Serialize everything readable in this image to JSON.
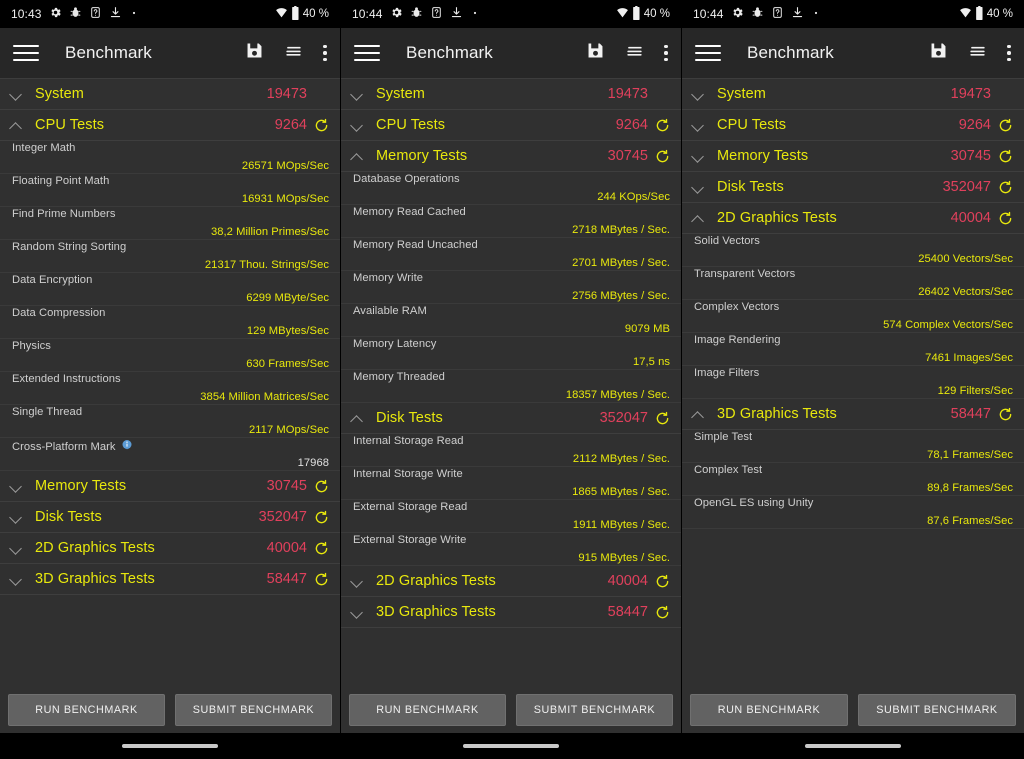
{
  "app": {
    "title": "Benchmark",
    "colors": {
      "group_label": "#e8e80d",
      "group_score": "#e0405c",
      "value": "#e8e80d",
      "background": "#303030",
      "appbar": "#272727",
      "row_name": "#cfcfcf"
    },
    "icons": {
      "menu": "hamburger-menu-icon",
      "save": "save-floppy-icon",
      "sort": "sort-lines-icon",
      "overflow": "overflow-menu-icon",
      "refresh": "refresh-icon",
      "info": "info-icon",
      "chevron_down": "chevron-down-icon",
      "chevron_up": "chevron-up-icon"
    },
    "buttons": {
      "run": "RUN BENCHMARK",
      "submit": "SUBMIT BENCHMARK"
    }
  },
  "panels": [
    {
      "statusbar": {
        "time": "10:43",
        "battery": "40 %",
        "icons": [
          "gear-icon",
          "bug-icon",
          "sim-card-icon",
          "download-icon",
          "dot-icon"
        ],
        "right_icons": [
          "wifi-icon",
          "battery-icon"
        ]
      },
      "rows": [
        {
          "kind": "group",
          "label": "System",
          "score": "19473",
          "expanded": false,
          "refresh": false
        },
        {
          "kind": "group",
          "label": "CPU Tests",
          "score": "9264",
          "expanded": true,
          "refresh": true
        },
        {
          "kind": "item",
          "name": "Integer Math",
          "value": "26571 MOps/Sec"
        },
        {
          "kind": "item",
          "name": "Floating Point Math",
          "value": "16931 MOps/Sec"
        },
        {
          "kind": "item",
          "name": "Find Prime Numbers",
          "value": "38,2 Million Primes/Sec"
        },
        {
          "kind": "item",
          "name": "Random String Sorting",
          "value": "21317 Thou. Strings/Sec"
        },
        {
          "kind": "item",
          "name": "Data Encryption",
          "value": "6299 MByte/Sec"
        },
        {
          "kind": "item",
          "name": "Data Compression",
          "value": "129 MBytes/Sec"
        },
        {
          "kind": "item",
          "name": "Physics",
          "value": "630 Frames/Sec"
        },
        {
          "kind": "item",
          "name": "Extended Instructions",
          "value": "3854 Million Matrices/Sec"
        },
        {
          "kind": "item",
          "name": "Single Thread",
          "value": "2117 MOps/Sec"
        },
        {
          "kind": "item",
          "name": "Cross-Platform Mark",
          "value": "17968",
          "info": true,
          "plain": true
        },
        {
          "kind": "group",
          "label": "Memory Tests",
          "score": "30745",
          "expanded": false,
          "refresh": true
        },
        {
          "kind": "group",
          "label": "Disk Tests",
          "score": "352047",
          "expanded": false,
          "refresh": true
        },
        {
          "kind": "group",
          "label": "2D Graphics Tests",
          "score": "40004",
          "expanded": false,
          "refresh": true
        },
        {
          "kind": "group",
          "label": "3D Graphics Tests",
          "score": "58447",
          "expanded": false,
          "refresh": true
        }
      ]
    },
    {
      "statusbar": {
        "time": "10:44",
        "battery": "40 %",
        "icons": [
          "gear-icon",
          "bug-icon",
          "sim-card-icon",
          "download-icon",
          "dot-icon"
        ],
        "right_icons": [
          "wifi-icon",
          "battery-icon"
        ]
      },
      "rows": [
        {
          "kind": "group",
          "label": "System",
          "score": "19473",
          "expanded": false,
          "refresh": false
        },
        {
          "kind": "group",
          "label": "CPU Tests",
          "score": "9264",
          "expanded": false,
          "refresh": true
        },
        {
          "kind": "group",
          "label": "Memory Tests",
          "score": "30745",
          "expanded": true,
          "refresh": true
        },
        {
          "kind": "item",
          "name": "Database Operations",
          "value": "244 KOps/Sec"
        },
        {
          "kind": "item",
          "name": "Memory Read Cached",
          "value": "2718 MBytes / Sec."
        },
        {
          "kind": "item",
          "name": "Memory Read Uncached",
          "value": "2701 MBytes / Sec."
        },
        {
          "kind": "item",
          "name": "Memory Write",
          "value": "2756 MBytes / Sec."
        },
        {
          "kind": "item",
          "name": "Available RAM",
          "value": "9079 MB"
        },
        {
          "kind": "item",
          "name": "Memory Latency",
          "value": "17,5 ns"
        },
        {
          "kind": "item",
          "name": "Memory Threaded",
          "value": "18357 MBytes / Sec."
        },
        {
          "kind": "group",
          "label": "Disk Tests",
          "score": "352047",
          "expanded": true,
          "refresh": true
        },
        {
          "kind": "item",
          "name": "Internal Storage Read",
          "value": "2112 MBytes / Sec."
        },
        {
          "kind": "item",
          "name": "Internal Storage Write",
          "value": "1865 MBytes / Sec."
        },
        {
          "kind": "item",
          "name": "External Storage Read",
          "value": "1911 MBytes / Sec."
        },
        {
          "kind": "item",
          "name": "External Storage Write",
          "value": "915 MBytes / Sec."
        },
        {
          "kind": "group",
          "label": "2D Graphics Tests",
          "score": "40004",
          "expanded": false,
          "refresh": true
        },
        {
          "kind": "group",
          "label": "3D Graphics Tests",
          "score": "58447",
          "expanded": false,
          "refresh": true
        }
      ]
    },
    {
      "statusbar": {
        "time": "10:44",
        "battery": "40 %",
        "icons": [
          "gear-icon",
          "bug-icon",
          "sim-card-icon",
          "download-icon",
          "dot-icon"
        ],
        "right_icons": [
          "wifi-icon",
          "battery-icon"
        ]
      },
      "rows": [
        {
          "kind": "group",
          "label": "System",
          "score": "19473",
          "expanded": false,
          "refresh": false
        },
        {
          "kind": "group",
          "label": "CPU Tests",
          "score": "9264",
          "expanded": false,
          "refresh": true
        },
        {
          "kind": "group",
          "label": "Memory Tests",
          "score": "30745",
          "expanded": false,
          "refresh": true
        },
        {
          "kind": "group",
          "label": "Disk Tests",
          "score": "352047",
          "expanded": false,
          "refresh": true
        },
        {
          "kind": "group",
          "label": "2D Graphics Tests",
          "score": "40004",
          "expanded": true,
          "refresh": true
        },
        {
          "kind": "item",
          "name": "Solid Vectors",
          "value": "25400 Vectors/Sec"
        },
        {
          "kind": "item",
          "name": "Transparent Vectors",
          "value": "26402 Vectors/Sec"
        },
        {
          "kind": "item",
          "name": "Complex Vectors",
          "value": "574 Complex Vectors/Sec"
        },
        {
          "kind": "item",
          "name": "Image Rendering",
          "value": "7461 Images/Sec"
        },
        {
          "kind": "item",
          "name": "Image Filters",
          "value": "129 Filters/Sec"
        },
        {
          "kind": "group",
          "label": "3D Graphics Tests",
          "score": "58447",
          "expanded": true,
          "refresh": true
        },
        {
          "kind": "item",
          "name": "Simple Test",
          "value": "78,1 Frames/Sec"
        },
        {
          "kind": "item",
          "name": "Complex Test",
          "value": "89,8 Frames/Sec"
        },
        {
          "kind": "item",
          "name": "OpenGL ES using Unity",
          "value": "87,6 Frames/Sec"
        }
      ]
    }
  ]
}
